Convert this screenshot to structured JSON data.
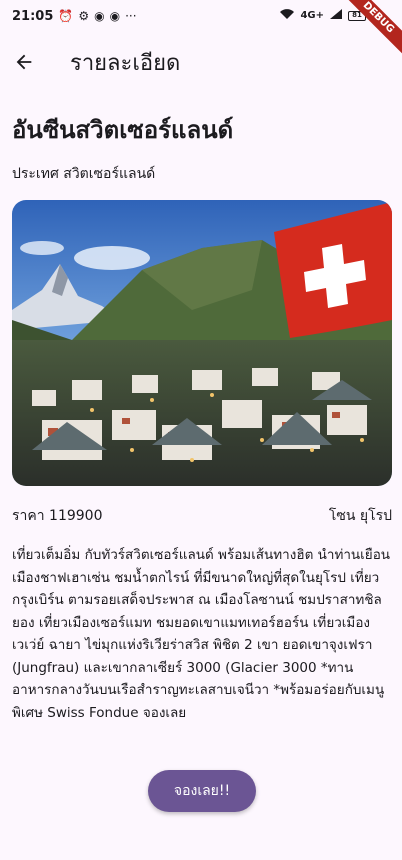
{
  "status_bar": {
    "time": "21:05",
    "left_icons": [
      "alarm-icon",
      "gear-icon",
      "messenger-icon",
      "messenger-icon"
    ],
    "more": "···",
    "battery": "81",
    "network": "4G+",
    "debug_label": "DEBUG"
  },
  "app_bar": {
    "back_icon": "arrow-back-icon",
    "title": "รายละเอียด"
  },
  "detail": {
    "name": "อันซีนสวิตเซอร์แลนด์",
    "country": "ประเทศ สวิตเซอร์แลนด์",
    "price": "ราคา 119900",
    "zone": "โซน ยุโรป",
    "description": "เที่ยวเต็มอิ่ม กับทัวร์สวิตเซอร์แลนด์ พร้อมเส้นทางฮิต นำท่านเยือนเมืองชาฟเฮาเซ่น ชมน้ำตกไรน์ ที่มีขนาดใหญ่ที่สุดในยุโรป เที่ยวกรุงเบิร์น ตามรอยเสด็จประพาส ณ เมืองโลซานน์ ชมปราสาทชิลยอง เที่ยวเมืองเซอร์แมท ชมยอดเขาแมทเทอร์ฮอร์น เที่ยวเมืองเวเว่ย์ ฉายา ไข่มุกแห่งริเวียร่าสวิส พิชิต 2 เขา ยอดเขาจุงเฟรา (Jungfrau) และเขากลาเซียร์ 3000 (Glacier 3000 *ทานอาหารกลางวันบนเรือสำราญทะเลสาบเจนีวา *พร้อมอร่อยกับเมนูพิเศษ Swiss Fondue จองเลย"
  },
  "book_button": {
    "label": "จองเลย!!"
  },
  "colors": {
    "background": "#fdf7fe",
    "accent": "#6b5594",
    "text": "#1c1b1f"
  }
}
